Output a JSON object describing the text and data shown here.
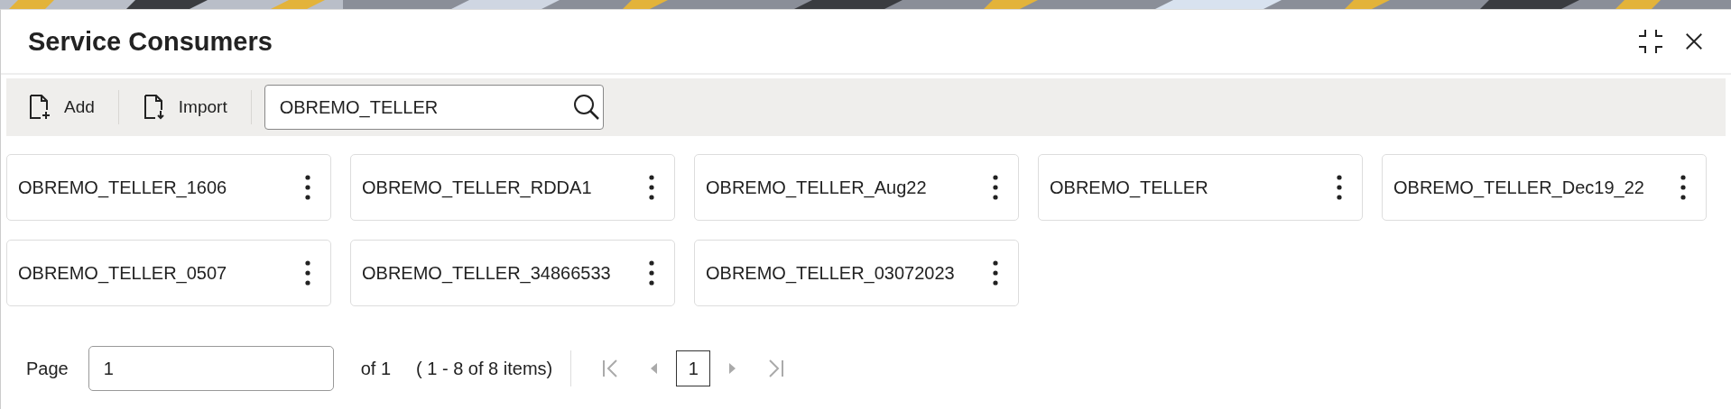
{
  "dialog": {
    "title": "Service Consumers"
  },
  "toolbar": {
    "buttons": [
      {
        "label": "Add",
        "kind": "add"
      },
      {
        "label": "Import",
        "kind": "import"
      }
    ],
    "search": {
      "value": "OBREMO_TELLER"
    }
  },
  "cards": [
    {
      "name": "OBREMO_TELLER_1606"
    },
    {
      "name": "OBREMO_TELLER_RDDA1"
    },
    {
      "name": "OBREMO_TELLER_Aug22"
    },
    {
      "name": "OBREMO_TELLER"
    },
    {
      "name": "OBREMO_TELLER_Dec19_22"
    },
    {
      "name": "OBREMO_TELLER_0507"
    },
    {
      "name": "OBREMO_TELLER_34866533"
    },
    {
      "name": "OBREMO_TELLER_03072023"
    }
  ],
  "pagination": {
    "page_label": "Page",
    "page_value": "1",
    "of_text": "of 1",
    "range_text": "( 1 - 8 of 8 items)",
    "nav": [
      {
        "kind": "first",
        "disabled": true
      },
      {
        "kind": "prev",
        "disabled": true
      },
      {
        "kind": "next",
        "disabled": true
      },
      {
        "kind": "last",
        "disabled": true
      }
    ],
    "pages": [
      {
        "label": "1",
        "selected": true
      }
    ]
  }
}
